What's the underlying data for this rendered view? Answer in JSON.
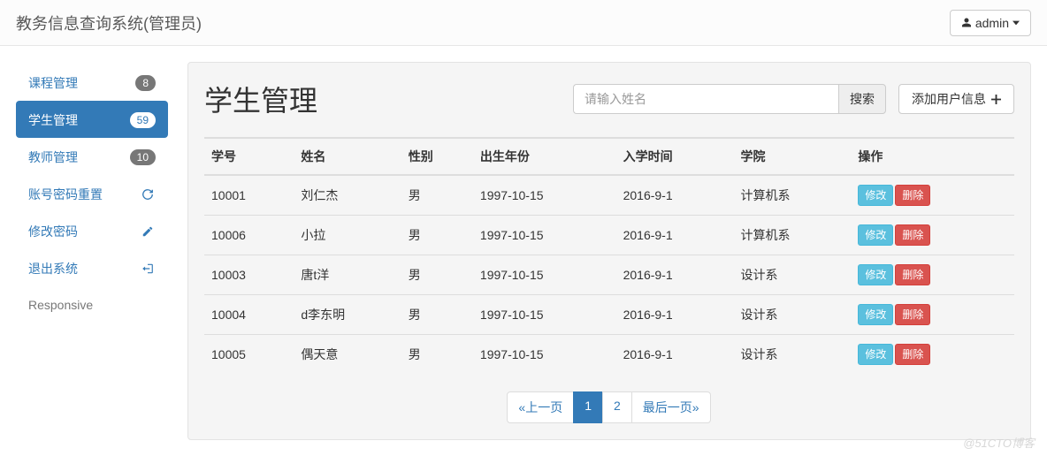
{
  "header": {
    "brand": "教务信息查询系统(管理员)",
    "user": "admin"
  },
  "sidebar": {
    "items": [
      {
        "label": "课程管理",
        "badge": "8",
        "active": false,
        "icon": null
      },
      {
        "label": "学生管理",
        "badge": "59",
        "active": true,
        "icon": null
      },
      {
        "label": "教师管理",
        "badge": "10",
        "active": false,
        "icon": null
      },
      {
        "label": "账号密码重置",
        "badge": null,
        "active": false,
        "icon": "refresh"
      },
      {
        "label": "修改密码",
        "badge": null,
        "active": false,
        "icon": "pencil"
      },
      {
        "label": "退出系统",
        "badge": null,
        "active": false,
        "icon": "logout"
      }
    ],
    "footer": "Responsive"
  },
  "main": {
    "title": "学生管理",
    "search": {
      "placeholder": "请输入姓名",
      "button": "搜索"
    },
    "add_button": "添加用户信息",
    "columns": [
      "学号",
      "姓名",
      "性别",
      "出生年份",
      "入学时间",
      "学院",
      "操作"
    ],
    "rows": [
      {
        "id": "10001",
        "name": "刘仁杰",
        "gender": "男",
        "birth": "1997-10-15",
        "enroll": "2016-9-1",
        "dept": "计算机系"
      },
      {
        "id": "10006",
        "name": "小拉",
        "gender": "男",
        "birth": "1997-10-15",
        "enroll": "2016-9-1",
        "dept": "计算机系"
      },
      {
        "id": "10003",
        "name": "唐t洋",
        "gender": "男",
        "birth": "1997-10-15",
        "enroll": "2016-9-1",
        "dept": "设计系"
      },
      {
        "id": "10004",
        "name": "d李东明",
        "gender": "男",
        "birth": "1997-10-15",
        "enroll": "2016-9-1",
        "dept": "设计系"
      },
      {
        "id": "10005",
        "name": "偶天意",
        "gender": "男",
        "birth": "1997-10-15",
        "enroll": "2016-9-1",
        "dept": "设计系"
      }
    ],
    "actions": {
      "edit": "修改",
      "delete": "删除"
    },
    "pagination": {
      "prev": "«上一页",
      "pages": [
        "1",
        "2"
      ],
      "current": "1",
      "last": "最后一页»"
    }
  },
  "watermark": "@51CTO博客"
}
